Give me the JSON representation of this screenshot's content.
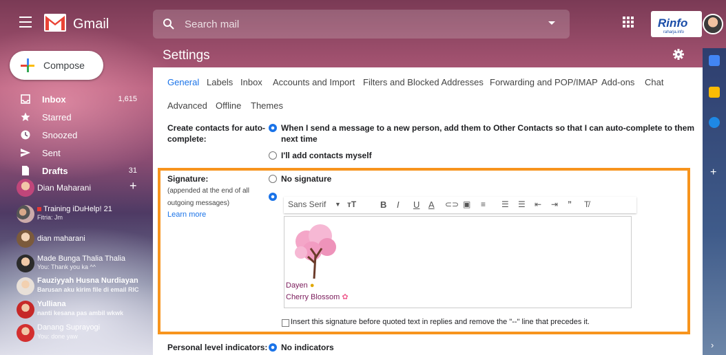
{
  "header": {
    "app_name": "Gmail",
    "search_placeholder": "Search mail",
    "brand_logo_text": "Rinfo",
    "brand_logo_sub": "raharja.info"
  },
  "sidebar": {
    "compose_label": "Compose",
    "items": [
      {
        "label": "Inbox",
        "count": "1,615",
        "icon": "inbox-icon",
        "bold": true
      },
      {
        "label": "Starred",
        "count": "",
        "icon": "star-icon",
        "bold": false
      },
      {
        "label": "Snoozed",
        "count": "",
        "icon": "clock-icon",
        "bold": false
      },
      {
        "label": "Sent",
        "count": "",
        "icon": "send-icon",
        "bold": false
      },
      {
        "label": "Drafts",
        "count": "31",
        "icon": "draft-icon",
        "bold": true
      }
    ],
    "chat_user": "Dian Maharani",
    "contacts": [
      {
        "name": "Training iDuHelp! 21",
        "sub": "Fitria: Jm",
        "unread": false
      },
      {
        "name": "dian maharani",
        "sub": "",
        "unread": false
      },
      {
        "name": "Made Bunga Thalia Thalia",
        "sub": "You: Thank you ka ^^",
        "unread": false
      },
      {
        "name": "Fauziyyah Husna Nurdiayan",
        "sub": "Barusan aku kirim file di email RIC",
        "unread": true
      },
      {
        "name": "Yulliana",
        "sub": "nanti kesana pas ambil wkwk",
        "unread": true
      },
      {
        "name": "Danang Suprayogi",
        "sub": "You: done yaw",
        "unread": false
      }
    ]
  },
  "settings": {
    "title": "Settings",
    "tabs_row1": [
      "General",
      "Labels",
      "Inbox",
      "Accounts and Import",
      "Filters and Blocked Addresses",
      "Forwarding and POP/IMAP",
      "Add-ons",
      "Chat"
    ],
    "tabs_row2": [
      "Advanced",
      "Offline",
      "Themes"
    ],
    "active_tab": "General",
    "contacts_row": {
      "label_line1": "Create contacts for auto-",
      "label_line2": "complete:",
      "option1_line1": "When I send a message to a new person, add them to Other Contacts so that I can auto-complete to them",
      "option1_line2": "next time",
      "option2": "I'll add contacts myself"
    },
    "signature": {
      "label": "Signature:",
      "sub_line1": "(appended at the end of all",
      "sub_line2": "outgoing messages)",
      "learn_more": "Learn more",
      "no_signature": "No signature",
      "font": "Sans Serif",
      "sig_line1": "Dayen",
      "sig_line2": "Cherry Blossom",
      "insert_before_quoted": "Insert this signature before quoted text in replies and remove the \"--\" line that precedes it."
    },
    "personal_row": {
      "label": "Personal level indicators:",
      "option": "No indicators"
    }
  },
  "colors": {
    "accent": "#1a73e8",
    "highlight": "#f7941d",
    "gmail_red": "#ea4335"
  }
}
